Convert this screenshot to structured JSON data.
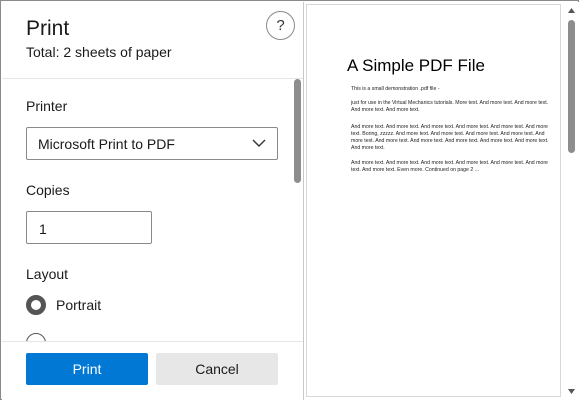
{
  "dialog": {
    "title": "Print",
    "subtitle": "Total: 2 sheets of paper",
    "help_glyph": "?"
  },
  "printer": {
    "label": "Printer",
    "selected": "Microsoft Print to PDF"
  },
  "copies": {
    "label": "Copies",
    "value": "1"
  },
  "layout": {
    "label": "Layout",
    "options": [
      {
        "label": "Portrait",
        "selected": true
      }
    ]
  },
  "footer": {
    "print_label": "Print",
    "cancel_label": "Cancel"
  },
  "preview": {
    "doc_title": "A Simple PDF File",
    "paragraphs": [
      "This is a small demonstration .pdf file -",
      "just for use in the Virtual Mechanics tutorials. More text. And more text. And more text. And more text. And more text.",
      "And more text. And more text. And more text. And more text. And more text. And more text. Boring, zzzzz. And more text. And more text. And more text. And more text. And more text. And more text. And more text. And more text. And more text. And more text. And more text.",
      "And more text. And more text. And more text. And more text. And more text. And more text. And more text. Even more. Continued on page 2 ..."
    ]
  },
  "colors": {
    "accent": "#0078d4",
    "scrollbar": "#8d8d8d"
  }
}
